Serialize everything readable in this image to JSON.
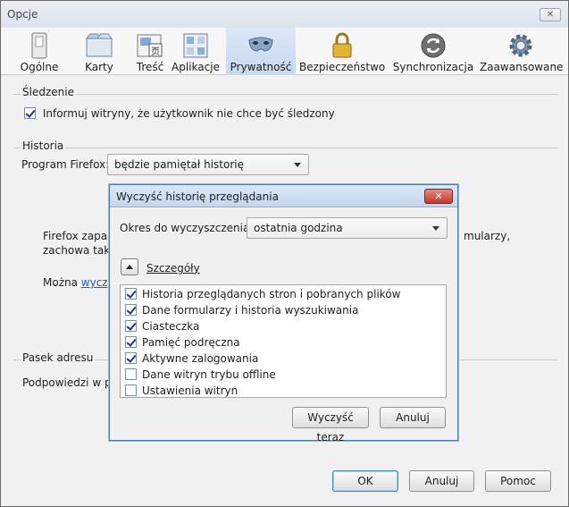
{
  "window": {
    "title": "Opcje",
    "close": "✕"
  },
  "toolbar": {
    "items": [
      {
        "label": "Ogólne",
        "icon": "switch-icon"
      },
      {
        "label": "Karty",
        "icon": "tabs-icon"
      },
      {
        "label": "Treść",
        "icon": "content-icon"
      },
      {
        "label": "Aplikacje",
        "icon": "applications-icon"
      },
      {
        "label": "Prywatność",
        "icon": "mask-icon"
      },
      {
        "label": "Bezpieczeństwo",
        "icon": "lock-icon"
      },
      {
        "label": "Synchronizacja",
        "icon": "sync-icon"
      },
      {
        "label": "Zaawansowane",
        "icon": "gear-icon"
      }
    ],
    "active_label": "Prywatność"
  },
  "tracking": {
    "legend": "Śledzenie",
    "checkbox_label": "Informuj witryny, że użytkownik nie chce być śledzony",
    "checked": true
  },
  "history": {
    "legend": "Historia",
    "program_label": "Program Firefox:",
    "select_value": "będzie pamiętał historię",
    "partial_text_1": "Firefox zapam",
    "partial_text_2": "zachowa także",
    "partial_text_right": "mularzy,",
    "partial_text_3": "Można",
    "partial_link": "wyczyś"
  },
  "address_bar": {
    "legend": "Pasek adresu",
    "partial_text": "Podpowiedzi w pa"
  },
  "dialog": {
    "title": "Wyczyść historię przeglądania",
    "close": "✕",
    "range_label": "Okres do wyczyszczenia:",
    "range_value": "ostatnia godzina",
    "details_label": "Szczegóły",
    "items": [
      {
        "label": "Historia przeglądanych stron i pobranych plików",
        "checked": true
      },
      {
        "label": "Dane formularzy i historia wyszukiwania",
        "checked": true
      },
      {
        "label": "Ciasteczka",
        "checked": true
      },
      {
        "label": "Pamięć podręczna",
        "checked": true
      },
      {
        "label": "Aktywne zalogowania",
        "checked": true
      },
      {
        "label": "Dane witryn trybu offline",
        "checked": false
      },
      {
        "label": "Ustawienia witryn",
        "checked": false
      }
    ],
    "clear_button": "Wyczyść teraz",
    "cancel_button": "Anuluj"
  },
  "footer": {
    "ok": "OK",
    "cancel": "Anuluj",
    "help": "Pomoc"
  }
}
